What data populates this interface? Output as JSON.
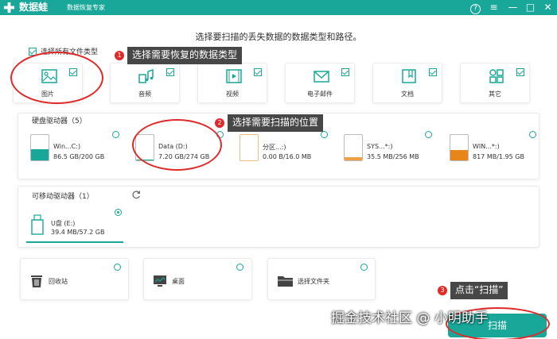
{
  "titlebar": {
    "app_name": "数据蛙",
    "subtitle": "数据恢复专家",
    "help": "?",
    "menu": "≡",
    "minimize": "—",
    "maximize": "□",
    "close": "✕"
  },
  "heading": "选择要扫描的丢失数据的数据类型和路径。",
  "select_all": {
    "label": "选择所有文件类型",
    "checked": true
  },
  "file_types": [
    {
      "label": "图片",
      "icon": "picture-icon",
      "checked": true
    },
    {
      "label": "音频",
      "icon": "audio-icon",
      "checked": true
    },
    {
      "label": "视频",
      "icon": "video-icon",
      "checked": true
    },
    {
      "label": "电子邮件",
      "icon": "email-icon",
      "checked": true
    },
    {
      "label": "文档",
      "icon": "document-icon",
      "checked": true
    },
    {
      "label": "其它",
      "icon": "other-icon",
      "checked": true
    }
  ],
  "hard_drives": {
    "title": "硬盘驱动器（5）",
    "drives": [
      {
        "name": "Win...C:)",
        "size": "86.5 GB/200 GB",
        "fill_percent": 43,
        "color": "#19a79a"
      },
      {
        "name": "Data (D:)",
        "size": "7.20 GB/274 GB",
        "fill_percent": 3,
        "color": "#19a79a"
      },
      {
        "name": "分区...:)",
        "size": "0.00  B/16.0 MB",
        "fill_percent": 0,
        "color": "#f0a040"
      },
      {
        "name": "SYS...*:)",
        "size": "35.5 MB/256 MB",
        "fill_percent": 14,
        "color": "#f0a040"
      },
      {
        "name": "WIN...*:)",
        "size": "817 MB/1.95 GB",
        "fill_percent": 42,
        "color": "#e8851a"
      }
    ]
  },
  "removable": {
    "title": "可移动驱动器（1）",
    "refresh_icon": "refresh-icon",
    "drive": {
      "name": "U盘 (E:)",
      "size": "39.4 MB/57.2 GB",
      "selected": true
    }
  },
  "locations": [
    {
      "label": "回收站",
      "icon": "recycle-bin-icon"
    },
    {
      "label": "桌面",
      "icon": "desktop-icon"
    },
    {
      "label": "选择文件夹",
      "icon": "folder-icon"
    }
  ],
  "callouts": [
    {
      "num": "1",
      "text": "选择需要恢复的数据类型"
    },
    {
      "num": "2",
      "text": "选择需要扫描的位置"
    },
    {
      "num": "3",
      "text": "点击“扫描”"
    }
  ],
  "scan_button": "扫描",
  "watermark": "掘金技术社区 @ 小明助手",
  "colors": {
    "accent": "#19a79a",
    "annotation": "#e02a2a"
  }
}
